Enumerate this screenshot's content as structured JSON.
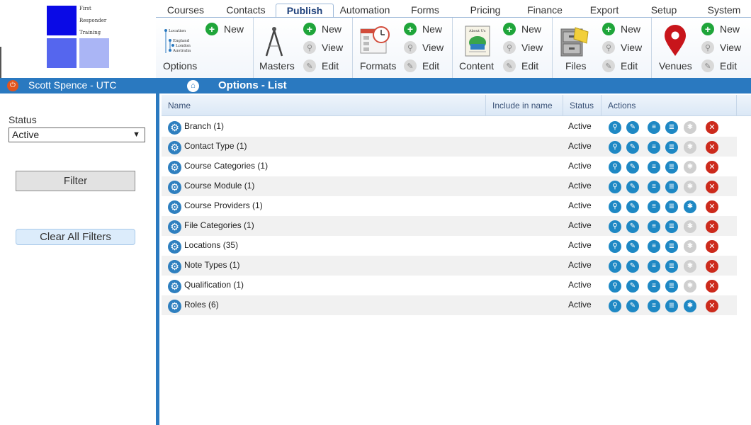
{
  "logo": {
    "line1": "First",
    "line2": "Responder",
    "line3": "Training"
  },
  "tabs": [
    "Courses",
    "Contacts",
    "Publish",
    "Automation",
    "Forms",
    "Pricing",
    "Finance",
    "Export",
    "Setup",
    "System"
  ],
  "ribbon": {
    "options": {
      "label": "Options",
      "new": "New",
      "tree": [
        "Location",
        "England",
        "London",
        "Australia"
      ]
    },
    "masters": {
      "label": "Masters",
      "new": "New",
      "view": "View",
      "edit": "Edit"
    },
    "formats": {
      "label": "Formats",
      "new": "New",
      "view": "View",
      "edit": "Edit"
    },
    "content": {
      "label": "Content",
      "new": "New",
      "view": "View",
      "edit": "Edit",
      "book_title": "About Us"
    },
    "files": {
      "label": "Files",
      "new": "New",
      "view": "View",
      "edit": "Edit"
    },
    "venues": {
      "label": "Venues",
      "new": "New",
      "view": "View",
      "edit": "Edit"
    }
  },
  "header": {
    "user": "Scott Spence - UTC",
    "page_title": "Options - List"
  },
  "sidebar": {
    "status_label": "Status",
    "status_value": "Active",
    "filter_button": "Filter",
    "clear_button": "Clear All Filters"
  },
  "grid": {
    "columns": [
      "Name",
      "Include in name",
      "Status",
      "Actions"
    ],
    "rows": [
      {
        "name": "Branch",
        "count": "(1)",
        "status": "Active",
        "fifth": "gray"
      },
      {
        "name": "Contact Type",
        "count": "(1)",
        "status": "Active",
        "fifth": "gray"
      },
      {
        "name": "Course Categories",
        "count": "(1)",
        "status": "Active",
        "fifth": "gray"
      },
      {
        "name": "Course Module",
        "count": "(1)",
        "status": "Active",
        "fifth": "gray"
      },
      {
        "name": "Course Providers",
        "count": "(1)",
        "status": "Active",
        "fifth": "blue"
      },
      {
        "name": "File Categories",
        "count": "(1)",
        "status": "Active",
        "fifth": "gray"
      },
      {
        "name": "Locations",
        "count": "(35)",
        "status": "Active",
        "fifth": "gray"
      },
      {
        "name": "Note Types",
        "count": "(1)",
        "status": "Active",
        "fifth": "gray"
      },
      {
        "name": "Qualification",
        "count": "(1)",
        "status": "Active",
        "fifth": "gray"
      },
      {
        "name": "Roles",
        "count": "(6)",
        "status": "Active",
        "fifth": "blue"
      }
    ]
  },
  "colors": {
    "accent": "#2a79c0",
    "new_green": "#1fa53a",
    "delete_red": "#cc2a1c",
    "action_blue": "#1e88c4"
  }
}
